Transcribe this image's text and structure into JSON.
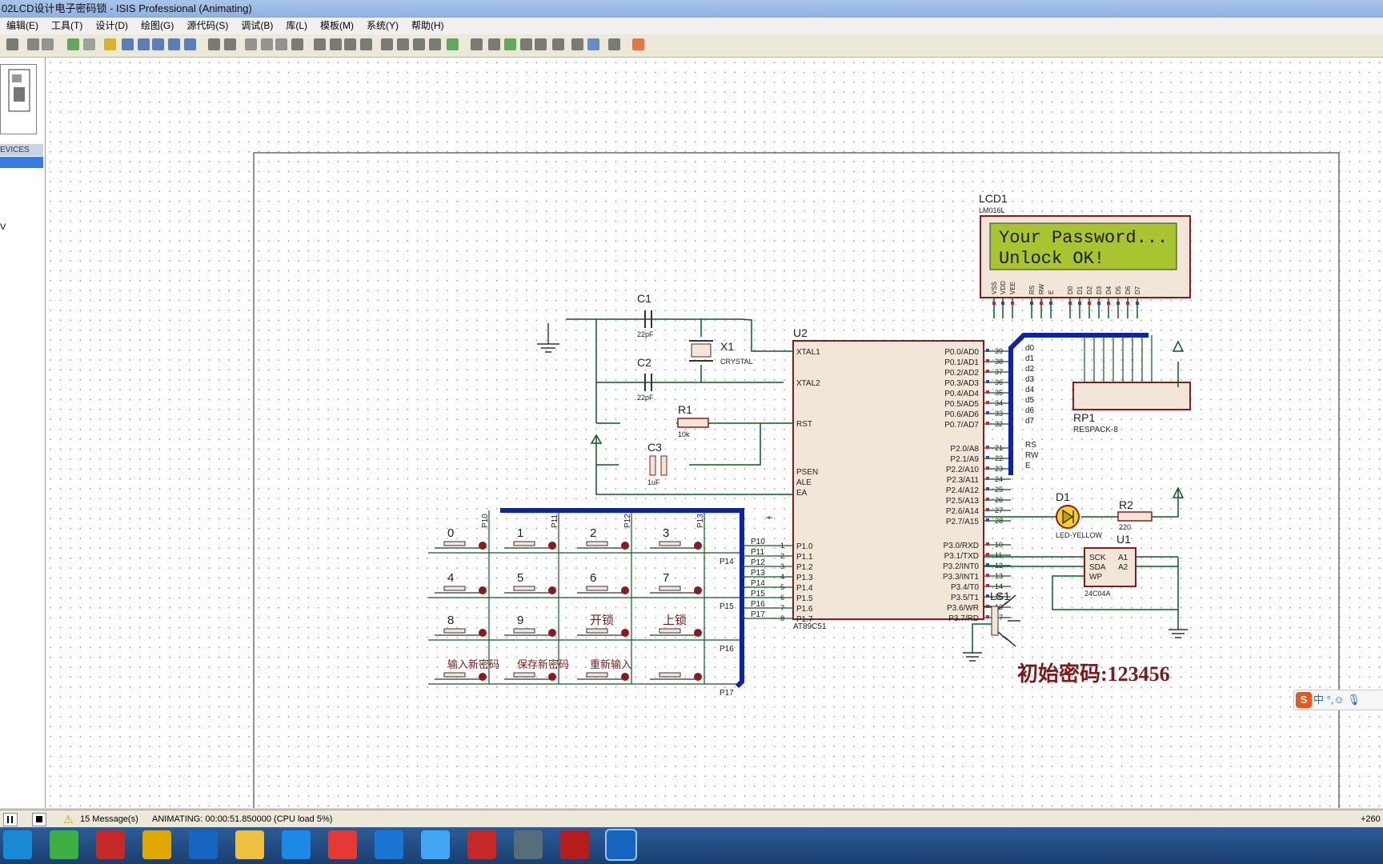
{
  "window": {
    "title": "02LCD设计电子密码锁 - ISIS Professional (Animating)"
  },
  "menu": [
    "编辑(E)",
    "工具(T)",
    "设计(D)",
    "绘图(G)",
    "源代码(S)",
    "调试(B)",
    "库(L)",
    "模板(M)",
    "系统(Y)",
    "帮助(H)"
  ],
  "side": {
    "devices_header": "EVICES",
    "partial_letter": "V"
  },
  "schematic": {
    "lcd_ref": "LCD1",
    "lcd_part": "LM016L",
    "lcd_line1": "Your Password...",
    "lcd_line2": "Unlock OK!",
    "c1": "C1",
    "c2": "C2",
    "c_val": "22pF",
    "x1": "X1",
    "crystal": "CRYSTAL",
    "r1": "R1",
    "r1_val": "10k",
    "c3": "C3",
    "c3_val": "1uF",
    "u2": "U2",
    "u2_part": "AT89C51",
    "rp1": "RP1",
    "rp1_part": "RESPACK-8",
    "d1": "D1",
    "d1_part": "LED-YELLOW",
    "r2": "R2",
    "r2_val": "220",
    "u1": "U1",
    "u1_part": "24C04A",
    "ls1": "LS1",
    "init_password": "初始密码:123456",
    "mcu_pins_left": [
      "XTAL1",
      "XTAL2",
      "RST",
      "PSEN",
      "ALE",
      "EA",
      "P1.0",
      "P1.1",
      "P1.2",
      "P1.3",
      "P1.4",
      "P1.5",
      "P1.6",
      "P1.7"
    ],
    "mcu_pins_right": [
      "P0.0/AD0",
      "P0.1/AD1",
      "P0.2/AD2",
      "P0.3/AD3",
      "P0.4/AD4",
      "P0.5/AD5",
      "P0.6/AD6",
      "P0.7/AD7",
      "P2.0/A8",
      "P2.1/A9",
      "P2.2/A10",
      "P2.3/A11",
      "P2.4/A12",
      "P2.5/A13",
      "P2.6/A14",
      "P2.7/A15",
      "P3.0/RXD",
      "P3.1/TXD",
      "P3.2/INT0",
      "P3.3/INT1",
      "P3.4/T0",
      "P3.5/T1",
      "P3.6/WR",
      "P3.7/RD"
    ],
    "right_pin_numbers": [
      "39",
      "38",
      "37",
      "36",
      "35",
      "34",
      "33",
      "32",
      "21",
      "22",
      "23",
      "24",
      "25",
      "26",
      "27",
      "28",
      "10",
      "11",
      "12",
      "13",
      "14",
      "15",
      "16",
      "17"
    ],
    "bus_labels_right": [
      "d0",
      "d1",
      "d2",
      "d3",
      "d4",
      "d5",
      "d6",
      "d7",
      "RS",
      "RW",
      "E"
    ],
    "lcd_pins": [
      "VSS",
      "VDD",
      "VEE",
      "RS",
      "RW",
      "E",
      "D0",
      "D1",
      "D2",
      "D3",
      "D4",
      "D5",
      "D6",
      "D7"
    ],
    "eeprom_pins": [
      "SCK",
      "SDA",
      "WP",
      "A1",
      "A2"
    ],
    "keys": [
      [
        "0",
        "1",
        "2",
        "3"
      ],
      [
        "4",
        "5",
        "6",
        "7"
      ],
      [
        "8",
        "9",
        "开锁",
        "上锁"
      ],
      [
        "输入新密码",
        "保存新密码",
        "重新输入",
        ""
      ]
    ],
    "key_row_nets": [
      "P14",
      "P15",
      "P16",
      "P17"
    ],
    "key_col_nets": [
      "P10",
      "P11",
      "P12",
      "P13"
    ],
    "p1_nets": [
      "P10",
      "P11",
      "P12",
      "P13",
      "P14",
      "P15",
      "P16",
      "P17"
    ]
  },
  "status": {
    "messages": "15 Message(s)",
    "animating": "ANIMATING: 00:00:51.850000 (CPU load 5%)",
    "coord": "+260"
  },
  "ime": {
    "label": "中 °,☺ 🎙"
  },
  "taskbar_apps": [
    "ie",
    "360",
    "red-app",
    "media",
    "k-app",
    "explorer",
    "tool",
    "chrome",
    "feather",
    "bird",
    "wps",
    "v-app",
    "recorder",
    "isis"
  ],
  "colors": {
    "title_bg": "#a9c4ea",
    "wire": "#0a5c1a",
    "component_border": "#8b1a1a",
    "component_fill": "#f2e6d8",
    "lcd_screen": "#a8c42e",
    "bus": "#0a22b0"
  }
}
